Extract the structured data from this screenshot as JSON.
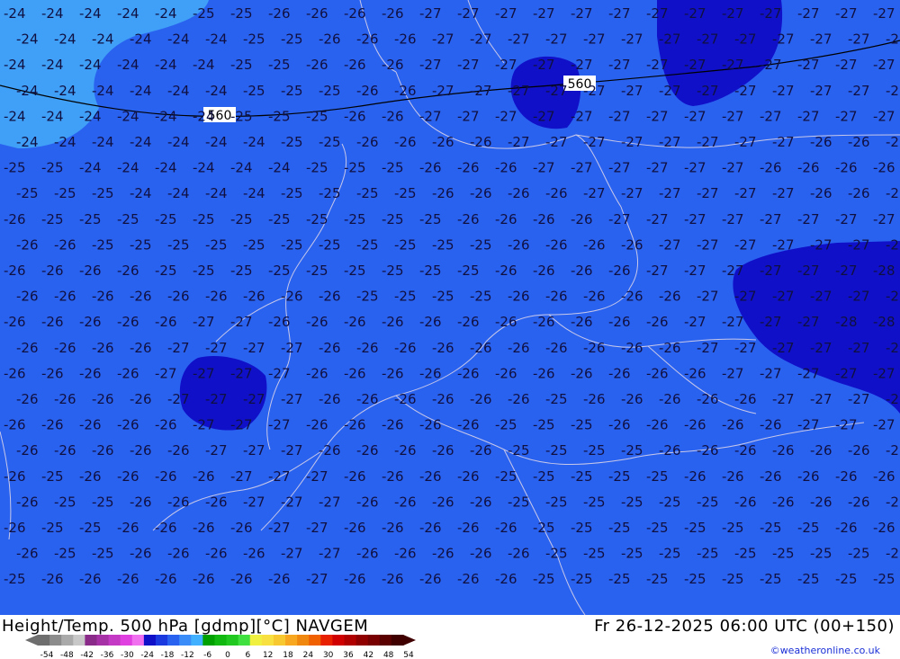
{
  "title_left": "Height/Temp. 500 hPa [gdmp][°C] NAVGEM",
  "title_right": "Fr 26-12-2025 06:00 UTC (00+150)",
  "credit": "©weatheronline.co.uk",
  "contour": {
    "labels": [
      "560",
      "560"
    ]
  },
  "legend": {
    "ticks": [
      "-54",
      "-48",
      "-42",
      "-36",
      "-30",
      "-24",
      "-18",
      "-12",
      "-6",
      "0",
      "6",
      "12",
      "18",
      "24",
      "30",
      "36",
      "42",
      "48",
      "54"
    ],
    "colors": [
      "#6e6e6e",
      "#8c8c8c",
      "#aaaaaa",
      "#c8c8c8",
      "#8a2b8a",
      "#a631a6",
      "#c43ac4",
      "#e040e0",
      "#f070f0",
      "#1010c8",
      "#1a3ae0",
      "#2a62f0",
      "#3a8cf8",
      "#40b0ff",
      "#00a000",
      "#10b810",
      "#20c820",
      "#40e040",
      "#f0f040",
      "#f8e040",
      "#f8c830",
      "#f8a820",
      "#f08810",
      "#f06000",
      "#e82000",
      "#d00000",
      "#b00000",
      "#900000",
      "#780000",
      "#5a0000",
      "#400000"
    ]
  },
  "map_colors": {
    "base": "#2a62f0",
    "cold_dark": "#1010c8",
    "warm_light": "#40a0f8",
    "label": "#101040",
    "border": "#c8c8e8"
  },
  "temperature_grid": [
    [
      "-24",
      "-24",
      "-24",
      "-24",
      "-24",
      "-25",
      "-25",
      "-26",
      "-26",
      "-26",
      "-26",
      "-27",
      "-27",
      "-27",
      "-27",
      "-27",
      "-27",
      "-27",
      "-27",
      "-27",
      "-27",
      "-27",
      "-27",
      "-27"
    ],
    [
      "-24",
      "-24",
      "-24",
      "-24",
      "-24",
      "-24",
      "-25",
      "-25",
      "-26",
      "-26",
      "-26",
      "-27",
      "-27",
      "-27",
      "-27",
      "-27",
      "-27",
      "-27",
      "-27",
      "-27",
      "-27",
      "-27",
      "-27",
      "-27"
    ],
    [
      "-24",
      "-24",
      "-24",
      "-24",
      "-24",
      "-24",
      "-25",
      "-25",
      "-26",
      "-26",
      "-26",
      "-27",
      "-27",
      "-27",
      "-27",
      "-27",
      "-27",
      "-27",
      "-27",
      "-27",
      "-27",
      "-27",
      "-27",
      "-27"
    ],
    [
      "-24",
      "-24",
      "-24",
      "-24",
      "-24",
      "-24",
      "-25",
      "-25",
      "-25",
      "-26",
      "-26",
      "-27",
      "-27",
      "-27",
      "-27",
      "-27",
      "-27",
      "-27",
      "-27",
      "-27",
      "-27",
      "-27",
      "-27",
      "-27"
    ],
    [
      "-24",
      "-24",
      "-24",
      "-24",
      "-24",
      "-24",
      "-25",
      "-25",
      "-25",
      "-26",
      "-26",
      "-27",
      "-27",
      "-27",
      "-27",
      "-27",
      "-27",
      "-27",
      "-27",
      "-27",
      "-27",
      "-27",
      "-27",
      "-27"
    ],
    [
      "-24",
      "-24",
      "-24",
      "-24",
      "-24",
      "-24",
      "-24",
      "-25",
      "-25",
      "-26",
      "-26",
      "-26",
      "-26",
      "-27",
      "-27",
      "-27",
      "-27",
      "-27",
      "-27",
      "-27",
      "-27",
      "-26",
      "-26",
      "-27"
    ],
    [
      "-25",
      "-25",
      "-24",
      "-24",
      "-24",
      "-24",
      "-24",
      "-24",
      "-25",
      "-25",
      "-25",
      "-26",
      "-26",
      "-26",
      "-27",
      "-27",
      "-27",
      "-27",
      "-27",
      "-27",
      "-26",
      "-26",
      "-26",
      "-26"
    ],
    [
      "-25",
      "-25",
      "-25",
      "-24",
      "-24",
      "-24",
      "-24",
      "-25",
      "-25",
      "-25",
      "-25",
      "-26",
      "-26",
      "-26",
      "-26",
      "-27",
      "-27",
      "-27",
      "-27",
      "-27",
      "-27",
      "-26",
      "-26",
      "-26"
    ],
    [
      "-26",
      "-25",
      "-25",
      "-25",
      "-25",
      "-25",
      "-25",
      "-25",
      "-25",
      "-25",
      "-25",
      "-25",
      "-26",
      "-26",
      "-26",
      "-26",
      "-27",
      "-27",
      "-27",
      "-27",
      "-27",
      "-27",
      "-27",
      "-27"
    ],
    [
      "-26",
      "-26",
      "-25",
      "-25",
      "-25",
      "-25",
      "-25",
      "-25",
      "-25",
      "-25",
      "-25",
      "-25",
      "-25",
      "-26",
      "-26",
      "-26",
      "-26",
      "-27",
      "-27",
      "-27",
      "-27",
      "-27",
      "-27",
      "-27"
    ],
    [
      "-26",
      "-26",
      "-26",
      "-26",
      "-25",
      "-25",
      "-25",
      "-25",
      "-25",
      "-25",
      "-25",
      "-25",
      "-25",
      "-26",
      "-26",
      "-26",
      "-26",
      "-27",
      "-27",
      "-27",
      "-27",
      "-27",
      "-27",
      "-28"
    ],
    [
      "-26",
      "-26",
      "-26",
      "-26",
      "-26",
      "-26",
      "-26",
      "-26",
      "-26",
      "-25",
      "-25",
      "-25",
      "-25",
      "-26",
      "-26",
      "-26",
      "-26",
      "-26",
      "-27",
      "-27",
      "-27",
      "-27",
      "-27",
      "-28"
    ],
    [
      "-26",
      "-26",
      "-26",
      "-26",
      "-26",
      "-27",
      "-27",
      "-26",
      "-26",
      "-26",
      "-26",
      "-26",
      "-26",
      "-26",
      "-26",
      "-26",
      "-26",
      "-26",
      "-27",
      "-27",
      "-27",
      "-27",
      "-28",
      "-28"
    ],
    [
      "-26",
      "-26",
      "-26",
      "-26",
      "-27",
      "-27",
      "-27",
      "-27",
      "-26",
      "-26",
      "-26",
      "-26",
      "-26",
      "-26",
      "-26",
      "-26",
      "-26",
      "-26",
      "-27",
      "-27",
      "-27",
      "-27",
      "-27",
      "-28"
    ],
    [
      "-26",
      "-26",
      "-26",
      "-26",
      "-27",
      "-27",
      "-27",
      "-27",
      "-26",
      "-26",
      "-26",
      "-26",
      "-26",
      "-26",
      "-26",
      "-26",
      "-26",
      "-26",
      "-26",
      "-27",
      "-27",
      "-27",
      "-27",
      "-27"
    ],
    [
      "-26",
      "-26",
      "-26",
      "-26",
      "-27",
      "-27",
      "-27",
      "-27",
      "-26",
      "-26",
      "-26",
      "-26",
      "-26",
      "-26",
      "-25",
      "-26",
      "-26",
      "-26",
      "-26",
      "-26",
      "-27",
      "-27",
      "-27",
      "-27"
    ],
    [
      "-26",
      "-26",
      "-26",
      "-26",
      "-26",
      "-27",
      "-27",
      "-27",
      "-26",
      "-26",
      "-26",
      "-26",
      "-26",
      "-25",
      "-25",
      "-25",
      "-26",
      "-26",
      "-26",
      "-26",
      "-26",
      "-27",
      "-27",
      "-27"
    ],
    [
      "-26",
      "-26",
      "-26",
      "-26",
      "-26",
      "-27",
      "-27",
      "-27",
      "-26",
      "-26",
      "-26",
      "-26",
      "-26",
      "-25",
      "-25",
      "-25",
      "-25",
      "-26",
      "-26",
      "-26",
      "-26",
      "-26",
      "-26",
      "-26"
    ],
    [
      "-26",
      "-25",
      "-26",
      "-26",
      "-26",
      "-26",
      "-27",
      "-27",
      "-27",
      "-26",
      "-26",
      "-26",
      "-26",
      "-25",
      "-25",
      "-25",
      "-25",
      "-25",
      "-26",
      "-26",
      "-26",
      "-26",
      "-26",
      "-26"
    ],
    [
      "-26",
      "-25",
      "-25",
      "-26",
      "-26",
      "-26",
      "-27",
      "-27",
      "-27",
      "-26",
      "-26",
      "-26",
      "-26",
      "-25",
      "-25",
      "-25",
      "-25",
      "-25",
      "-25",
      "-26",
      "-26",
      "-26",
      "-26",
      "-26"
    ],
    [
      "-26",
      "-25",
      "-25",
      "-26",
      "-26",
      "-26",
      "-26",
      "-27",
      "-27",
      "-26",
      "-26",
      "-26",
      "-26",
      "-26",
      "-25",
      "-25",
      "-25",
      "-25",
      "-25",
      "-25",
      "-25",
      "-25",
      "-26",
      "-26"
    ],
    [
      "-26",
      "-25",
      "-25",
      "-26",
      "-26",
      "-26",
      "-26",
      "-27",
      "-27",
      "-26",
      "-26",
      "-26",
      "-26",
      "-26",
      "-25",
      "-25",
      "-25",
      "-25",
      "-25",
      "-25",
      "-25",
      "-25",
      "-25",
      "-25"
    ],
    [
      "-25",
      "-26",
      "-26",
      "-26",
      "-26",
      "-26",
      "-26",
      "-26",
      "-27",
      "-26",
      "-26",
      "-26",
      "-26",
      "-26",
      "-25",
      "-25",
      "-25",
      "-25",
      "-25",
      "-25",
      "-25",
      "-25",
      "-25",
      "-25"
    ]
  ]
}
